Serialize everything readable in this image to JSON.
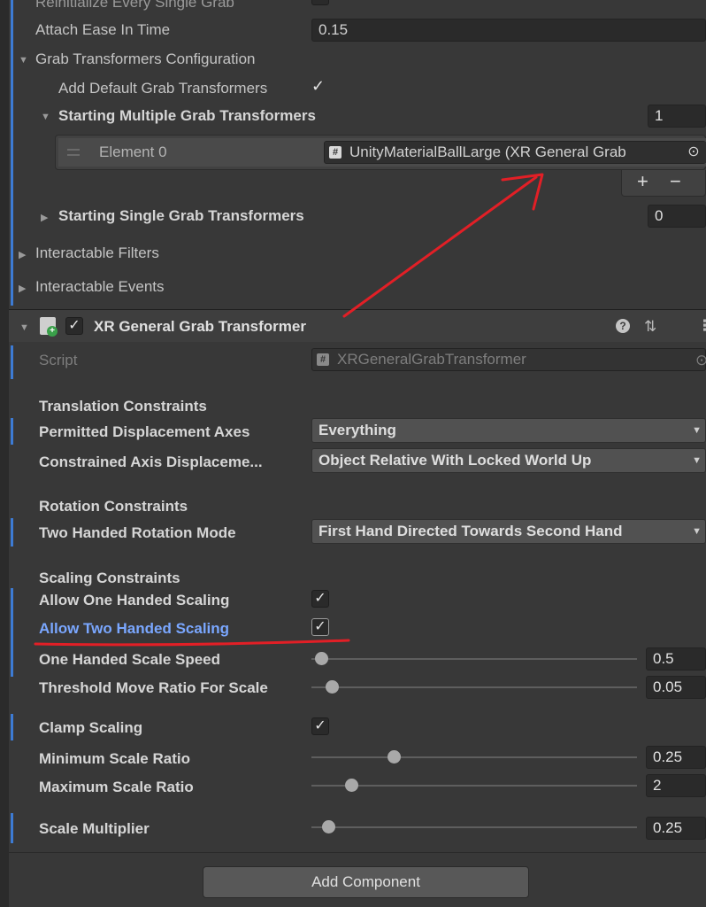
{
  "top": {
    "partial_label": "Reinitialize Every Single Grab",
    "attach_ease_label": "Attach Ease In Time",
    "attach_ease_value": "0.15",
    "grab_config_label": "Grab Transformers Configuration",
    "add_default_label": "Add Default Grab Transformers",
    "starting_multiple_label": "Starting Multiple Grab Transformers",
    "starting_multiple_count": "1",
    "element0_label": "Element 0",
    "element0_value": "UnityMaterialBallLarge (XR General Grab",
    "plus": "+",
    "minus": "−",
    "starting_single_label": "Starting Single Grab Transformers",
    "starting_single_count": "0",
    "interactable_filters": "Interactable Filters",
    "interactable_events": "Interactable Events"
  },
  "component": {
    "title": "XR General Grab Transformer",
    "help_glyph": "?",
    "settings_glyph": "⇅",
    "menu_glyph": "⋮",
    "script_label": "Script",
    "script_value": "XRGeneralGrabTransformer"
  },
  "translation": {
    "header": "Translation Constraints",
    "permitted_label": "Permitted Displacement Axes",
    "permitted_value": "Everything",
    "constrained_label": "Constrained Axis Displaceme...",
    "constrained_value": "Object Relative With Locked World Up"
  },
  "rotation": {
    "header": "Rotation Constraints",
    "two_handed_label": "Two Handed Rotation Mode",
    "two_handed_value": "First Hand Directed Towards Second Hand"
  },
  "scaling": {
    "header": "Scaling Constraints",
    "allow_one_label": "Allow One Handed Scaling",
    "allow_two_label": "Allow Two Handed Scaling",
    "one_speed_label": "One Handed Scale Speed",
    "one_speed_value": "0.5",
    "threshold_label": "Threshold Move Ratio For Scale",
    "threshold_value": "0.05",
    "clamp_label": "Clamp Scaling",
    "min_ratio_label": "Minimum Scale Ratio",
    "min_ratio_value": "0.25",
    "max_ratio_label": "Maximum Scale Ratio",
    "max_ratio_value": "2",
    "multiplier_label": "Scale Multiplier",
    "multiplier_value": "0.25"
  },
  "footer": {
    "add_component": "Add Component"
  },
  "colors": {
    "highlight_label": "#7aa7ff",
    "annotation_red": "#e21f26",
    "accent_bar": "#3d7bd4"
  }
}
